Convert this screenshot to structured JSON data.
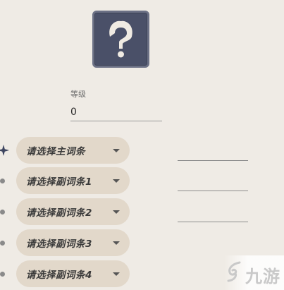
{
  "level": {
    "label": "等级",
    "value": "0"
  },
  "main_stat": {
    "label": "请选择主词条",
    "bullet_icon": "four-point-star-icon"
  },
  "sub_stats": [
    {
      "label": "请选择副词条1"
    },
    {
      "label": "请选择副词条2"
    },
    {
      "label": "请选择副词条3"
    },
    {
      "label": "请选择副词条4"
    }
  ],
  "artifact_slot": {
    "icon": "question-mark-icon"
  },
  "watermark": {
    "text": "九游",
    "icon": "jiuyou-logo-icon"
  },
  "colors": {
    "background": "#efebe5",
    "select_bg": "#e2d8ca",
    "slot_bg": "#4a5068",
    "slot_border": "#6b7085"
  }
}
